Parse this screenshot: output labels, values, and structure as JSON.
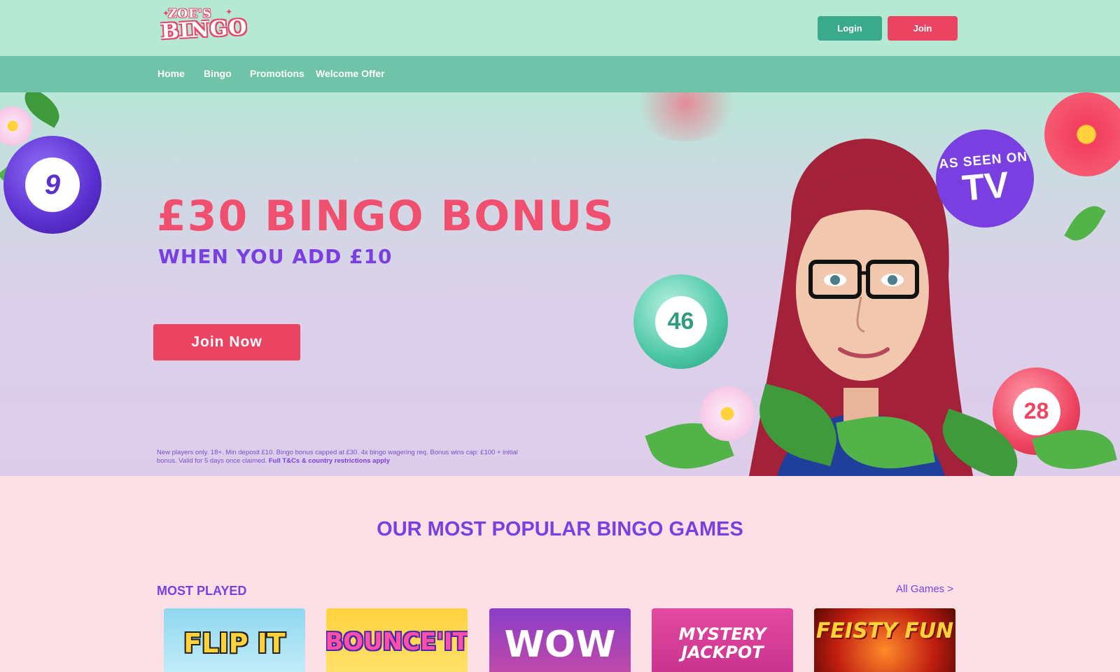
{
  "header": {
    "logo_line1": "ZOE'S",
    "logo_line2": "BINGO",
    "login_label": "Login",
    "join_label": "Join"
  },
  "nav": {
    "items": [
      {
        "label": "Home"
      },
      {
        "label": "Bingo"
      },
      {
        "label": "Promotions"
      },
      {
        "label": "Welcome Offer"
      }
    ]
  },
  "hero": {
    "title": "£30 BINGO BONUS",
    "subtitle": "WHEN YOU ADD £10",
    "cta_label": "Join Now",
    "terms_text": "New players only. 18+. Min deposit £10. Bingo bonus capped at £30. 4x bingo wagering req. Bonus wins cap: £100 + initial bonus. Valid for 5 days once claimed. ",
    "terms_link": "Full T&Cs & country restrictions apply",
    "badge_line1": "AS SEEN ON",
    "badge_line2": "TV",
    "balls": [
      "9",
      "46",
      "28"
    ]
  },
  "games_section": {
    "title": "OUR MOST POPULAR BINGO GAMES",
    "category": "MOST PLAYED",
    "all_games_label": "All Games >",
    "games": [
      {
        "name": "FLIP IT"
      },
      {
        "name": "BOUNCE'IT"
      },
      {
        "name": "WOW"
      },
      {
        "name": "MYSTERY JACKPOT"
      },
      {
        "name": "FEISTY FUN"
      }
    ]
  },
  "colors": {
    "header_bg": "#b5e9d3",
    "nav_bg": "#6fc3a8",
    "accent_pink": "#ea4462",
    "accent_purple": "#7a3fe0",
    "login_green": "#3aa98c"
  }
}
